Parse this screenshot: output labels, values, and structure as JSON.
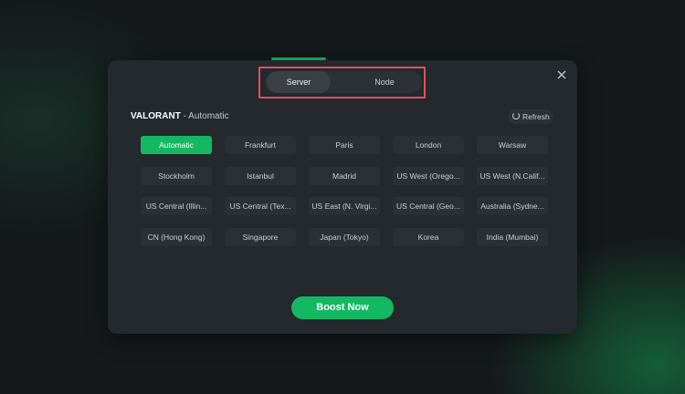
{
  "colors": {
    "accent": "#14b863",
    "highlight_box": "#e0505a"
  },
  "tabs": [
    {
      "label": "Server",
      "active": true
    },
    {
      "label": "Node",
      "active": false
    }
  ],
  "game": {
    "name": "VALORANT",
    "mode": " - Automatic"
  },
  "refresh_label": "Refresh",
  "servers": [
    [
      "Automatic",
      "Frankfurt",
      "Paris",
      "London",
      "Warsaw"
    ],
    [
      "Stockholm",
      "Istanbul",
      "Madrid",
      "US West (Orego...",
      "US West (N.Calif..."
    ],
    [
      "US Central (Illin...",
      "US Central (Tex...",
      "US East (N. Virgi...",
      "US Central (Geo...",
      "Australia (Sydne..."
    ],
    [
      "CN (Hong Kong)",
      "Singapore",
      "Japan (Tokyo)",
      "Korea",
      "India (Mumbai)"
    ]
  ],
  "selected_server": "Automatic",
  "boost_label": "Boost Now",
  "icons": {
    "close": "close-icon",
    "refresh": "refresh-icon"
  }
}
